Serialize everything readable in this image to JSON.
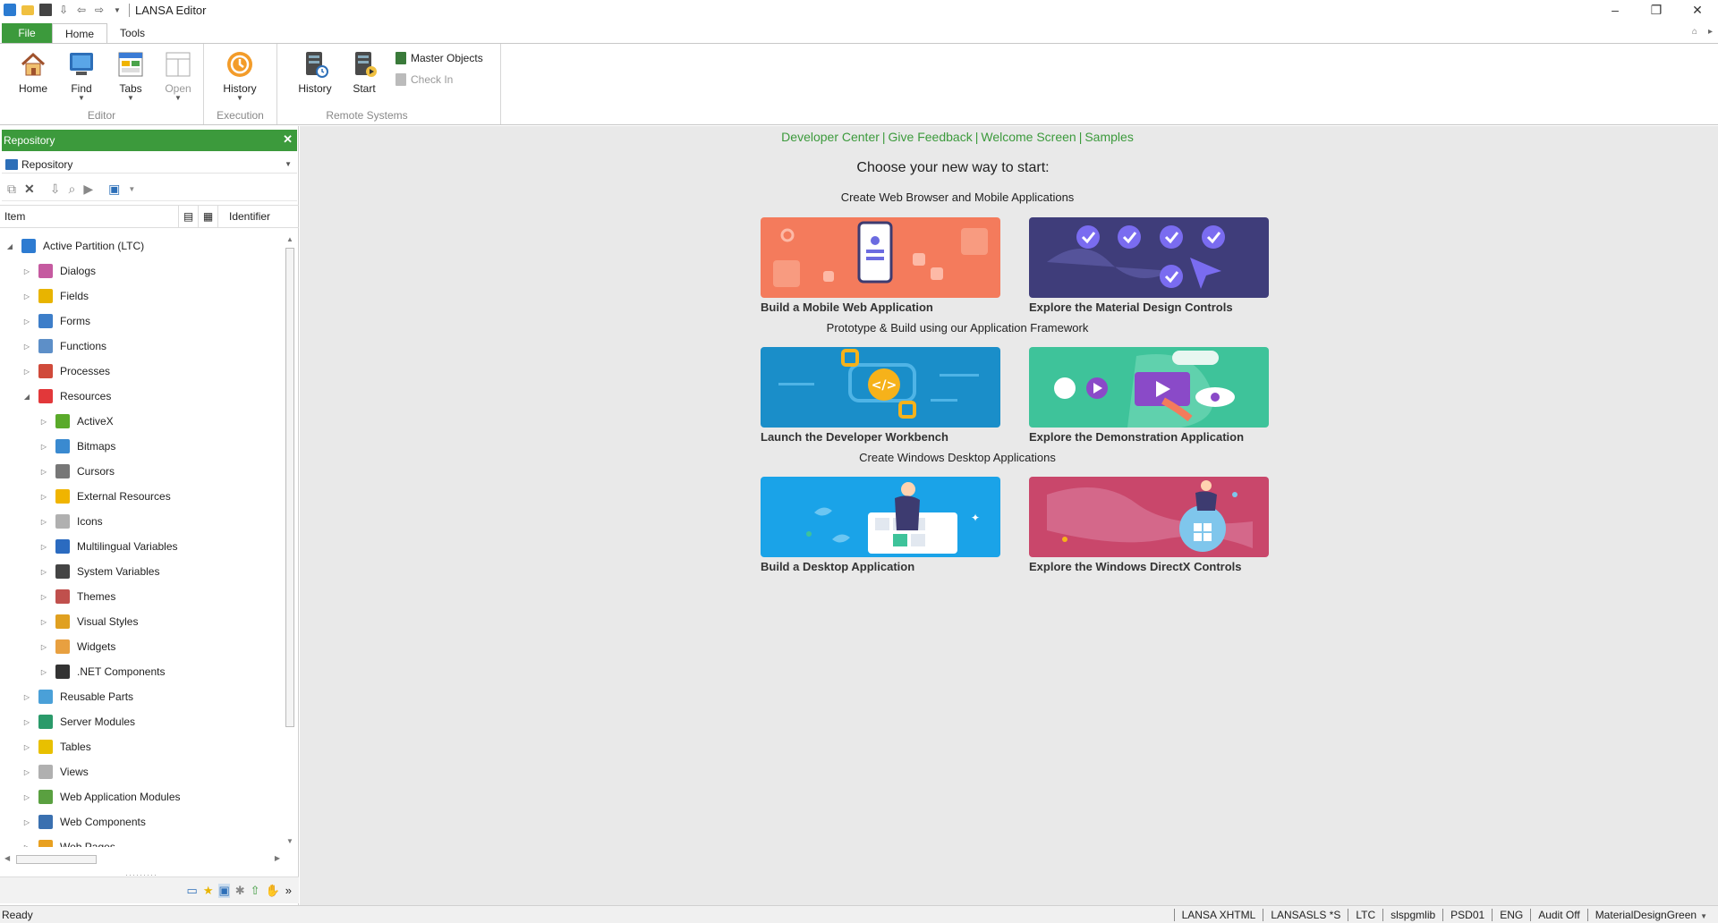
{
  "window": {
    "title": "LANSA Editor"
  },
  "ribbon": {
    "tabs": [
      "File",
      "Home",
      "Tools"
    ],
    "groups": {
      "editor": {
        "label": "Editor",
        "buttons": [
          "Home",
          "Find",
          "Tabs",
          "Open"
        ]
      },
      "execution": {
        "label": "Execution",
        "buttons": [
          "History"
        ]
      },
      "remote": {
        "label": "Remote Systems",
        "buttons": [
          "History",
          "Start"
        ],
        "small": [
          "Master Objects",
          "Check In"
        ]
      }
    }
  },
  "panel": {
    "title": "Repository",
    "selector": "Repository",
    "columns": {
      "item": "Item",
      "identifier": "Identifier"
    },
    "tree": [
      {
        "label": "Active Partition (LTC)",
        "level": 0,
        "expanded": true,
        "icon": "partition-icon",
        "color": "#2d7bd1"
      },
      {
        "label": "Dialogs",
        "level": 1,
        "expanded": false,
        "icon": "dialogs-icon",
        "color": "#c55aa0"
      },
      {
        "label": "Fields",
        "level": 1,
        "expanded": false,
        "icon": "fields-icon",
        "color": "#e8b400"
      },
      {
        "label": "Forms",
        "level": 1,
        "expanded": false,
        "icon": "forms-icon",
        "color": "#3d7ec9"
      },
      {
        "label": "Functions",
        "level": 1,
        "expanded": false,
        "icon": "functions-icon",
        "color": "#5d8fc8"
      },
      {
        "label": "Processes",
        "level": 1,
        "expanded": false,
        "icon": "processes-icon",
        "color": "#d04a3a"
      },
      {
        "label": "Resources",
        "level": 1,
        "expanded": true,
        "icon": "resources-icon",
        "color": "#e2383a"
      },
      {
        "label": "ActiveX",
        "level": 2,
        "expanded": false,
        "icon": "activex-icon",
        "color": "#5aaa2a"
      },
      {
        "label": "Bitmaps",
        "level": 2,
        "expanded": false,
        "icon": "bitmaps-icon",
        "color": "#3a8ad0"
      },
      {
        "label": "Cursors",
        "level": 2,
        "expanded": false,
        "icon": "cursors-icon",
        "color": "#777777"
      },
      {
        "label": "External Resources",
        "level": 2,
        "expanded": false,
        "icon": "external-resources-icon",
        "color": "#f0b400"
      },
      {
        "label": "Icons",
        "level": 2,
        "expanded": false,
        "icon": "icons-icon",
        "color": "#b0b0b0"
      },
      {
        "label": "Multilingual Variables",
        "level": 2,
        "expanded": false,
        "icon": "multilingual-icon",
        "color": "#2b6bc0"
      },
      {
        "label": "System Variables",
        "level": 2,
        "expanded": false,
        "icon": "system-variables-icon",
        "color": "#444444"
      },
      {
        "label": "Themes",
        "level": 2,
        "expanded": false,
        "icon": "themes-icon",
        "color": "#c0504d"
      },
      {
        "label": "Visual Styles",
        "level": 2,
        "expanded": false,
        "icon": "visual-styles-icon",
        "color": "#e0a020"
      },
      {
        "label": "Widgets",
        "level": 2,
        "expanded": false,
        "icon": "widgets-icon",
        "color": "#e8a040"
      },
      {
        "label": ".NET Components",
        "level": 2,
        "expanded": false,
        "icon": "dotnet-icon",
        "color": "#333333"
      },
      {
        "label": "Reusable Parts",
        "level": 1,
        "expanded": false,
        "icon": "reusable-parts-icon",
        "color": "#4aa0d8"
      },
      {
        "label": "Server Modules",
        "level": 1,
        "expanded": false,
        "icon": "server-modules-icon",
        "color": "#2a9a6a"
      },
      {
        "label": "Tables",
        "level": 1,
        "expanded": false,
        "icon": "tables-icon",
        "color": "#e8c000"
      },
      {
        "label": "Views",
        "level": 1,
        "expanded": false,
        "icon": "views-icon",
        "color": "#b0b0b0"
      },
      {
        "label": "Web Application Modules",
        "level": 1,
        "expanded": false,
        "icon": "web-app-modules-icon",
        "color": "#5aa040"
      },
      {
        "label": "Web Components",
        "level": 1,
        "expanded": false,
        "icon": "web-components-icon",
        "color": "#3a70b0"
      },
      {
        "label": "Web Pages",
        "level": 1,
        "expanded": false,
        "icon": "web-pages-icon",
        "color": "#e8a020"
      }
    ]
  },
  "main": {
    "links": [
      "Developer Center",
      "Give Feedback",
      "Welcome Screen",
      "Samples"
    ],
    "heading": "Choose your new way to start:",
    "sections": [
      {
        "title": "Create Web Browser and Mobile Applications",
        "cards": [
          {
            "label": "Build a Mobile Web Application",
            "bg": "#f47b5c"
          },
          {
            "label": "Explore the Material Design Controls",
            "bg": "#3f3d7a"
          }
        ]
      },
      {
        "title": "Prototype & Build using our Application Framework",
        "cards": [
          {
            "label": "Launch the Developer Workbench",
            "bg": "#1a8ec9"
          },
          {
            "label": "Explore the Demonstration Application",
            "bg": "#3ec39a"
          }
        ]
      },
      {
        "title": "Create Windows Desktop Applications",
        "cards": [
          {
            "label": "Build a Desktop Application",
            "bg": "#1aa3e8"
          },
          {
            "label": "Explore the Windows DirectX Controls",
            "bg": "#c9476b"
          }
        ]
      }
    ]
  },
  "status": {
    "left": "Ready",
    "cells": [
      "LANSA XHTML",
      "LANSASLS *S",
      "LTC",
      "slspgmlib",
      "PSD01",
      "ENG",
      "Audit Off",
      "MaterialDesignGreen"
    ]
  }
}
